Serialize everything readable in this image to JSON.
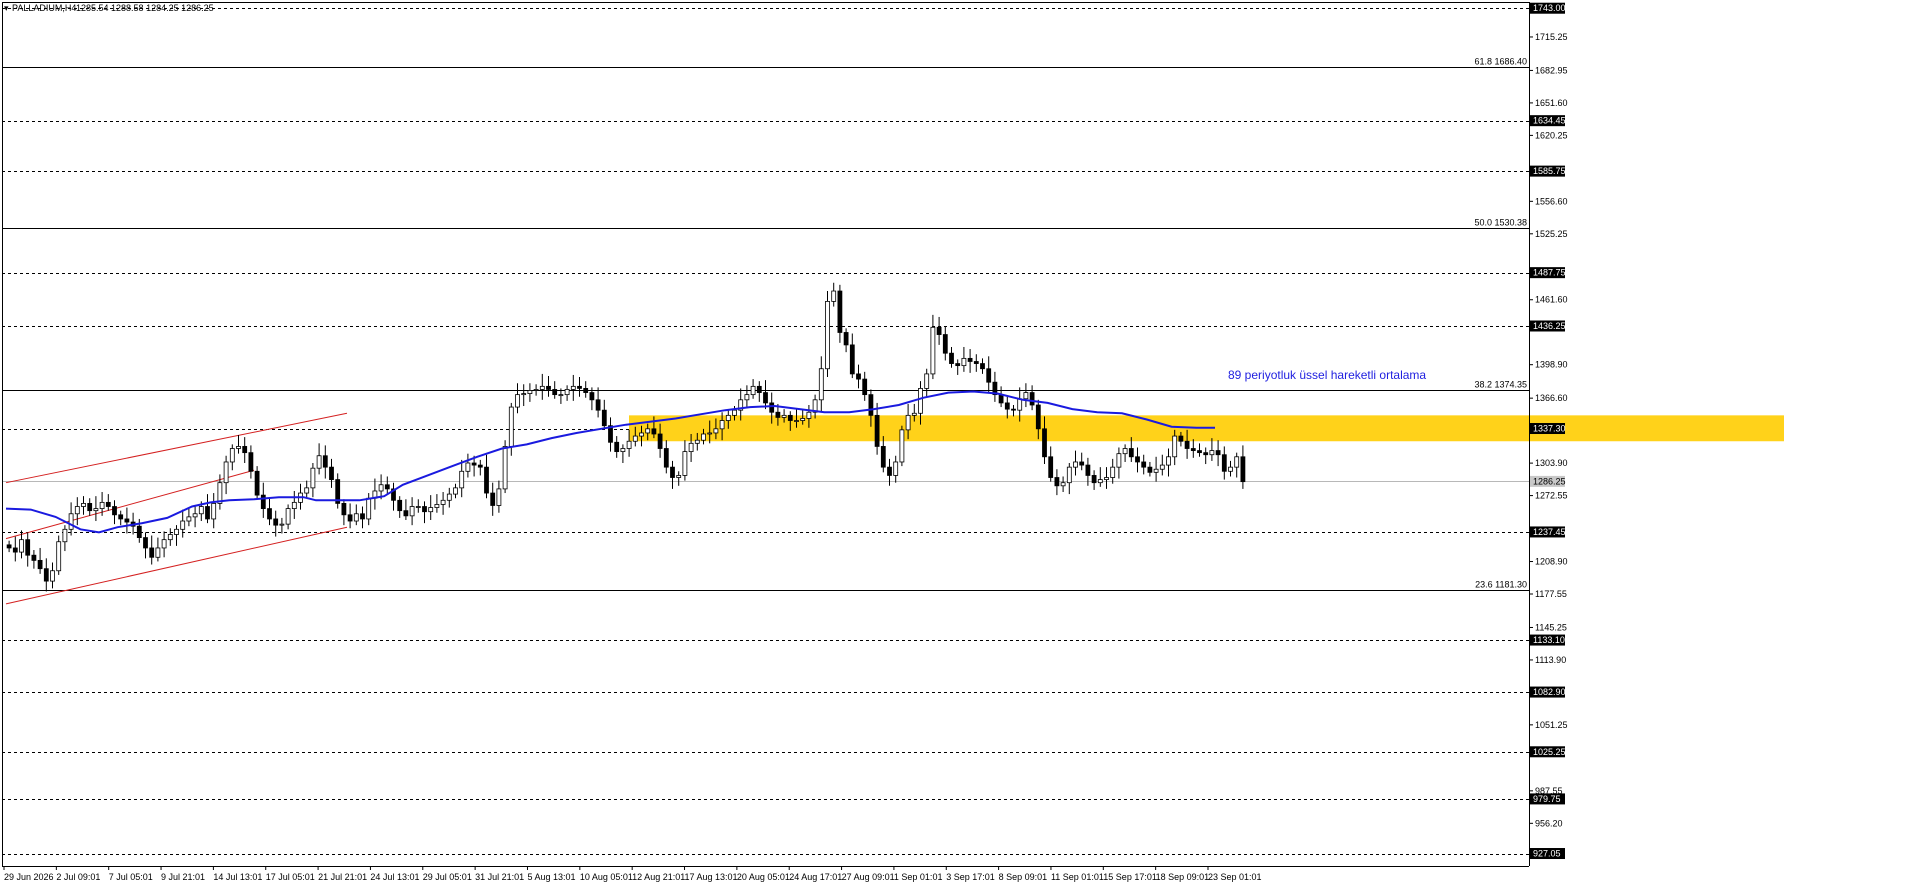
{
  "symbol_header": {
    "symbol": "PALLADIUM,H4",
    "ohlc": "1285.54 1288.58 1284.25 1286.25"
  },
  "chart_data": {
    "type": "candlestick",
    "instrument": "PALLADIUM",
    "timeframe": "H4",
    "ylim": [
      915,
      1749
    ],
    "y_ticks": [
      1715.25,
      1682.95,
      1651.6,
      1620.25,
      1556.6,
      1525.25,
      1461.6,
      1398.9,
      1366.6,
      1303.9,
      1272.55,
      1208.9,
      1177.55,
      1145.25,
      1113.9,
      1051.25,
      987.55,
      956.2
    ],
    "x_ticks": [
      "29 Jun 2026",
      "2 Jul 09:01",
      "7 Jul 05:01",
      "9 Jul 21:01",
      "14 Jul 13:01",
      "17 Jul 05:01",
      "21 Jul 21:01",
      "24 Jul 13:01",
      "29 Jul 05:01",
      "31 Jul 21:01",
      "5 Aug 13:01",
      "10 Aug 05:01",
      "12 Aug 21:01",
      "17 Aug 13:01",
      "20 Aug 05:01",
      "24 Aug 17:01",
      "27 Aug 09:01",
      "1 Sep 01:01",
      "3 Sep 17:01",
      "8 Sep 09:01",
      "11 Sep 01:01",
      "15 Sep 17:01",
      "18 Sep 09:01",
      "23 Sep 01:01"
    ],
    "current_price": 1286.25,
    "horizontal_levels": [
      {
        "price": 1743.0,
        "label": "1743.00",
        "style": "dashed"
      },
      {
        "price": 1634.45,
        "label": "1634.45",
        "style": "dashed"
      },
      {
        "price": 1585.75,
        "label": "1585.75",
        "style": "dashed"
      },
      {
        "price": 1487.75,
        "label": "1487.75",
        "style": "dashed"
      },
      {
        "price": 1436.25,
        "label": "1436.25",
        "style": "dashed"
      },
      {
        "price": 1337.3,
        "label": "1337.30",
        "style": "dashed"
      },
      {
        "price": 1237.45,
        "label": "1237.45",
        "style": "dashed"
      },
      {
        "price": 1133.1,
        "label": "1133.10",
        "style": "dashed"
      },
      {
        "price": 1082.9,
        "label": "1082.90",
        "style": "dashed"
      },
      {
        "price": 1025.25,
        "label": "1025.25",
        "style": "dashed"
      },
      {
        "price": 979.75,
        "label": "979.75",
        "style": "dashed"
      },
      {
        "price": 927.05,
        "label": "927.05",
        "style": "dashed"
      }
    ],
    "fibonacci_levels": [
      {
        "price": 1686.4,
        "label": "61.8 1686.40"
      },
      {
        "price": 1530.38,
        "label": "50.0 1530.38"
      },
      {
        "price": 1374.35,
        "label": "38.2 1374.35"
      },
      {
        "price": 1181.3,
        "label": "23.6 1181.30"
      }
    ],
    "support_zone": {
      "from": 1325,
      "to": 1350,
      "color": "#ffd21a"
    },
    "ema_line": {
      "color": "#1a1adf",
      "points": [
        [
          0,
          1260
        ],
        [
          4,
          1259
        ],
        [
          8,
          1252
        ],
        [
          12,
          1240
        ],
        [
          15,
          1237
        ],
        [
          18,
          1242
        ],
        [
          22,
          1246
        ],
        [
          26,
          1251
        ],
        [
          30,
          1262
        ],
        [
          33,
          1266
        ],
        [
          36,
          1268
        ],
        [
          40,
          1269
        ],
        [
          44,
          1271
        ],
        [
          48,
          1271
        ],
        [
          50,
          1268
        ],
        [
          54,
          1268
        ],
        [
          57,
          1268
        ],
        [
          61,
          1272
        ],
        [
          64,
          1283
        ],
        [
          68,
          1292
        ],
        [
          72,
          1301
        ],
        [
          76,
          1310
        ],
        [
          80,
          1318
        ],
        [
          84,
          1322
        ],
        [
          88,
          1328
        ],
        [
          92,
          1333
        ],
        [
          96,
          1337
        ],
        [
          100,
          1341
        ],
        [
          104,
          1344
        ],
        [
          108,
          1347
        ],
        [
          112,
          1351
        ],
        [
          116,
          1355
        ],
        [
          120,
          1358
        ],
        [
          124,
          1359
        ],
        [
          128,
          1356
        ],
        [
          132,
          1353
        ],
        [
          136,
          1353
        ],
        [
          140,
          1356
        ],
        [
          144,
          1360
        ],
        [
          148,
          1367
        ],
        [
          152,
          1372
        ],
        [
          156,
          1373
        ],
        [
          160,
          1371
        ],
        [
          164,
          1365
        ],
        [
          168,
          1362
        ],
        [
          172,
          1356
        ],
        [
          176,
          1353
        ],
        [
          180,
          1352
        ],
        [
          184,
          1346
        ],
        [
          188,
          1339
        ],
        [
          192,
          1338
        ],
        [
          195,
          1338
        ]
      ]
    },
    "annotation": {
      "text": "89 periyotluk üssel hareketli ortalama"
    },
    "channels": [
      {
        "color": "#d42020",
        "lines": [
          [
            [
              0,
              1285
            ],
            [
              55,
              1352
            ]
          ],
          [
            [
              0,
              1168
            ],
            [
              55,
              1242
            ]
          ],
          [
            [
              0,
              1231
            ],
            [
              40,
              1297
            ]
          ]
        ]
      }
    ],
    "price_path": [
      1225,
      1222,
      1218,
      1230,
      1215,
      1210,
      1202,
      1190,
      1200,
      1228,
      1240,
      1255,
      1262,
      1265,
      1258,
      1260,
      1266,
      1262,
      1254,
      1250,
      1247,
      1243,
      1232,
      1222,
      1213,
      1222,
      1230,
      1235,
      1240,
      1248,
      1252,
      1255,
      1262,
      1250,
      1265,
      1285,
      1305,
      1318,
      1320,
      1314,
      1296,
      1273,
      1260,
      1250,
      1244,
      1245,
      1260,
      1266,
      1275,
      1280,
      1299,
      1311,
      1300,
      1288,
      1265,
      1254,
      1248,
      1255,
      1250,
      1270,
      1277,
      1283,
      1279,
      1268,
      1258,
      1253,
      1262,
      1262,
      1257,
      1261,
      1264,
      1268,
      1274,
      1280,
      1296,
      1304,
      1302,
      1300,
      1275,
      1263,
      1279,
      1320,
      1358,
      1370,
      1371,
      1374,
      1375,
      1378,
      1375,
      1370,
      1370,
      1375,
      1378,
      1376,
      1372,
      1365,
      1355,
      1340,
      1324,
      1315,
      1318,
      1325,
      1330,
      1333,
      1337,
      1332,
      1318,
      1300,
      1290,
      1292,
      1315,
      1323,
      1326,
      1332,
      1333,
      1337,
      1345,
      1350,
      1355,
      1365,
      1370,
      1378,
      1372,
      1362,
      1353,
      1348,
      1350,
      1345,
      1345,
      1347,
      1353,
      1365,
      1395,
      1460,
      1470,
      1430,
      1418,
      1390,
      1385,
      1370,
      1350,
      1320,
      1300,
      1292,
      1305,
      1336,
      1350,
      1352,
      1376,
      1390,
      1435,
      1428,
      1410,
      1400,
      1398,
      1405,
      1402,
      1400,
      1395,
      1382,
      1370,
      1362,
      1356,
      1355,
      1366,
      1372,
      1360,
      1337,
      1310,
      1290,
      1282,
      1285,
      1300,
      1305,
      1302,
      1292,
      1285,
      1288,
      1290,
      1300,
      1313,
      1318,
      1310,
      1305,
      1300,
      1295,
      1298,
      1302,
      1310,
      1330,
      1325,
      1318,
      1316,
      1314,
      1312,
      1316,
      1312,
      1296,
      1300,
      1310,
      1286
    ]
  },
  "colors": {
    "background": "#ffffff",
    "grid": "#000000",
    "candle": "#000000",
    "ema": "#1a1adf",
    "zone": "#ffd21a",
    "channel": "#d42020",
    "tag_background": "#000000"
  }
}
